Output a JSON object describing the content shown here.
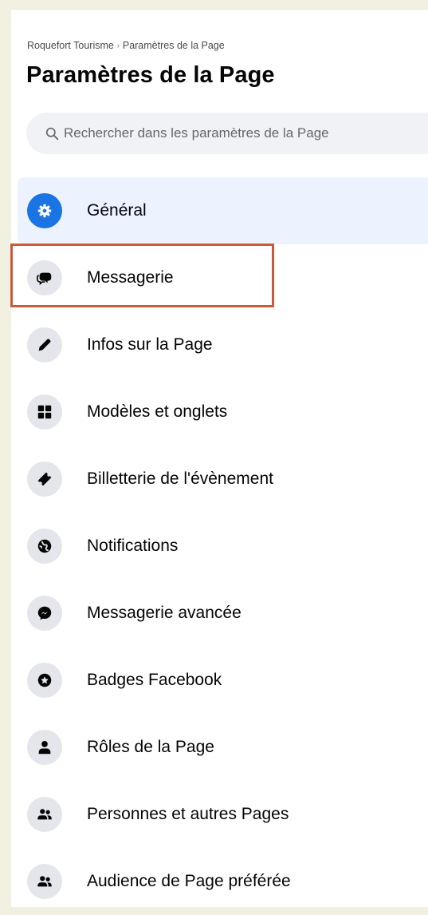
{
  "breadcrumb": {
    "page": "Roquefort Tourisme",
    "separator": "›",
    "current": "Paramètres de la Page"
  },
  "title": "Paramètres de la Page",
  "search": {
    "placeholder": "Rechercher dans les paramètres de la Page",
    "value": "",
    "icon": "search-icon"
  },
  "menu": {
    "items": [
      {
        "label": "Général",
        "icon": "gear-icon",
        "active": true
      },
      {
        "label": "Messagerie",
        "icon": "chat-bubbles-icon",
        "active": false,
        "highlighted": true
      },
      {
        "label": "Infos sur la Page",
        "icon": "pencil-icon",
        "active": false
      },
      {
        "label": "Modèles et onglets",
        "icon": "grid-icon",
        "active": false
      },
      {
        "label": "Billetterie de l'évènement",
        "icon": "ticket-icon",
        "active": false
      },
      {
        "label": "Notifications",
        "icon": "globe-icon",
        "active": false
      },
      {
        "label": "Messagerie avancée",
        "icon": "messenger-icon",
        "active": false
      },
      {
        "label": "Badges Facebook",
        "icon": "badge-star-icon",
        "active": false
      },
      {
        "label": "Rôles de la Page",
        "icon": "person-icon",
        "active": false
      },
      {
        "label": "Personnes et autres Pages",
        "icon": "people-icon",
        "active": false
      },
      {
        "label": "Audience de Page préférée",
        "icon": "people-icon",
        "active": false
      }
    ]
  },
  "colors": {
    "accent": "#1b74e4",
    "active_background": "#ecf3ff",
    "icon_background": "#e4e6eb",
    "icon_glyph": "#050505",
    "annotation_outline": "#cc5a3a",
    "outer_background": "#f2f0e1"
  }
}
